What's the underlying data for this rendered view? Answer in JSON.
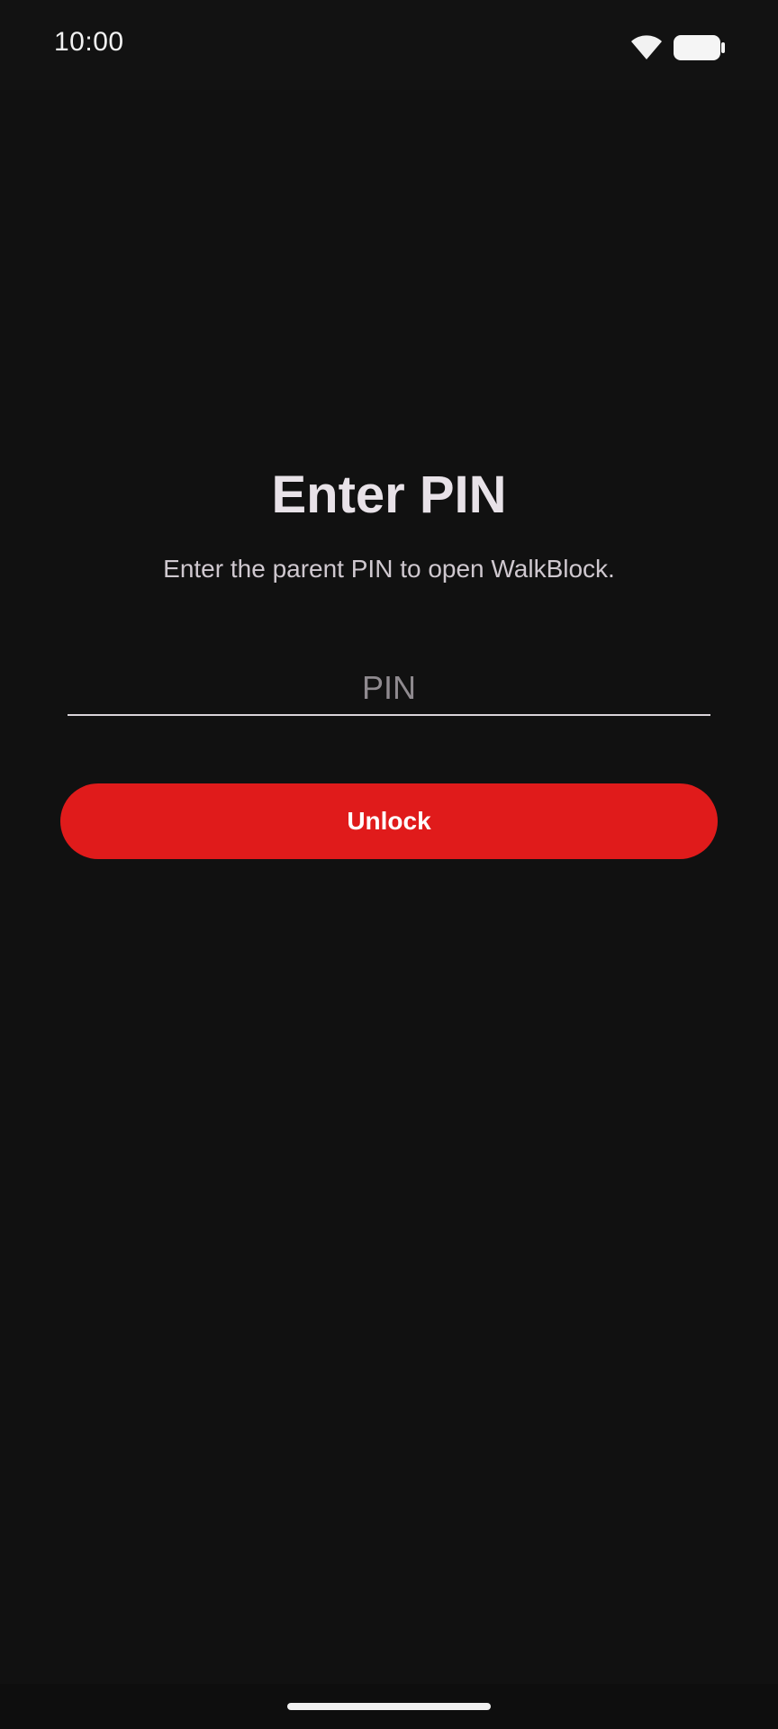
{
  "status_bar": {
    "time": "10:00",
    "wifi_icon": "wifi-icon",
    "battery_icon": "battery-icon"
  },
  "screen": {
    "title": "Enter PIN",
    "subtitle": "Enter the parent PIN to open WalkBlock.",
    "pin_input": {
      "value": "",
      "placeholder": "PIN"
    },
    "unlock_label": "Unlock"
  },
  "colors": {
    "background": "#111111",
    "accent": "#e01b1b",
    "text_primary": "#e8e2e8",
    "text_secondary": "#cfc8cf",
    "placeholder": "#8f8a8f"
  },
  "navigation": {
    "home_indicator": "home-indicator"
  }
}
